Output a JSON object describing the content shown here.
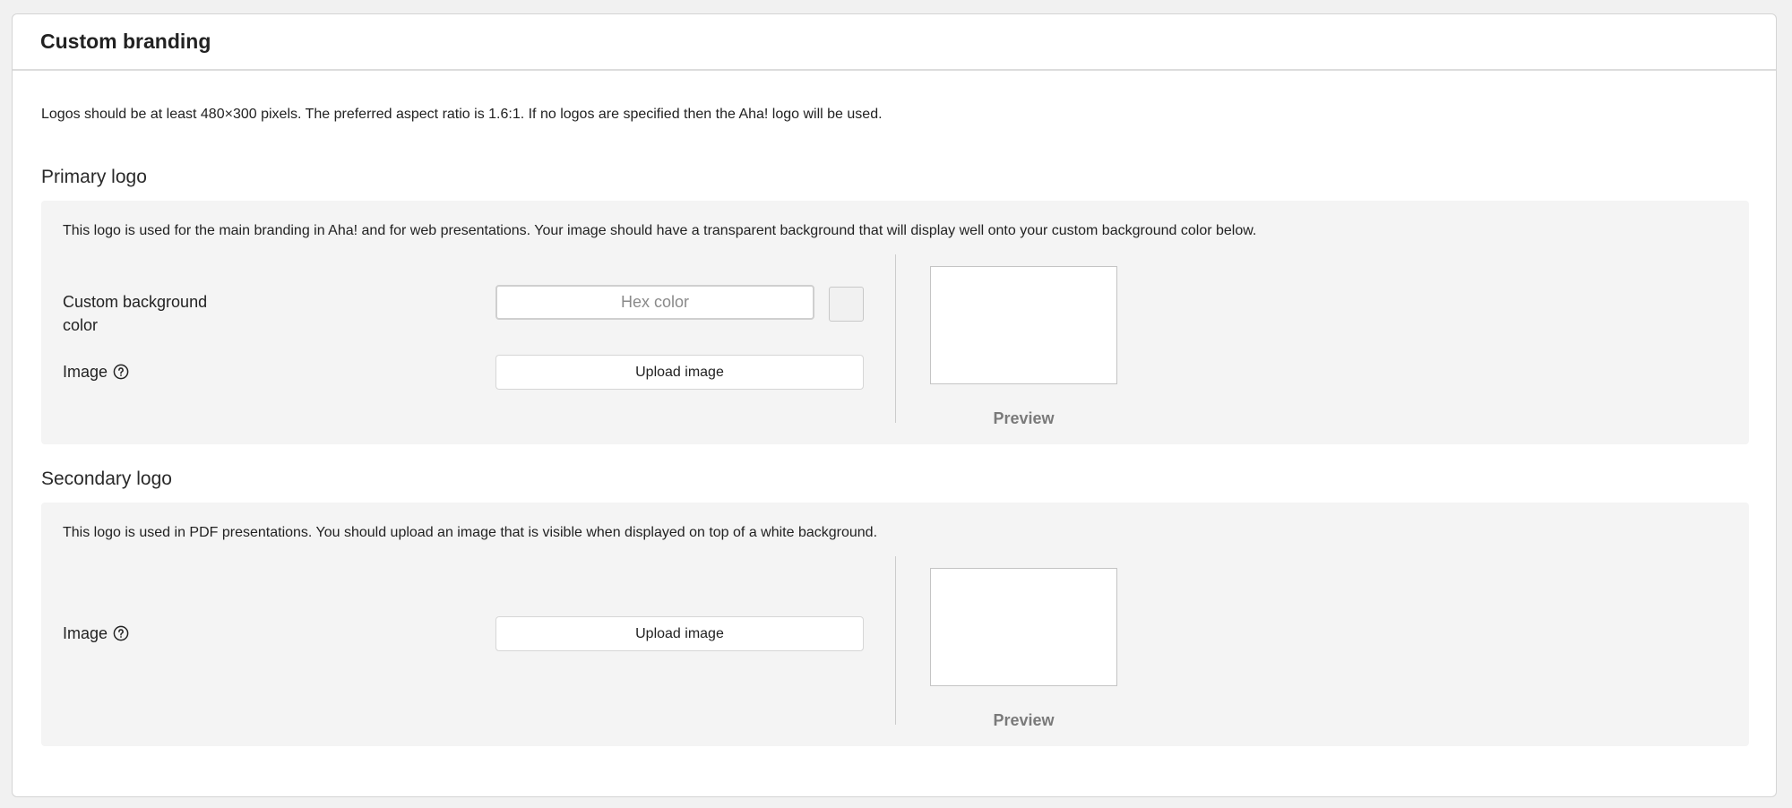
{
  "card": {
    "title": "Custom branding",
    "intro": "Logos should be at least 480×300 pixels. The preferred aspect ratio is 1.6:1. If no logos are specified then the Aha! logo will be used."
  },
  "primary": {
    "title": "Primary logo",
    "description": "This logo is used for the main branding in Aha! and for web presentations. Your image should have a transparent background that will display well onto your custom background color below.",
    "bg_label_line1": "Custom background",
    "bg_label_line2": "color",
    "hex_placeholder": "Hex color",
    "hex_value": "",
    "image_label": "Image",
    "upload_label": "Upload image",
    "preview_label": "Preview"
  },
  "secondary": {
    "title": "Secondary logo",
    "description": "This logo is used in PDF presentations. You should upload an image that is visible when displayed on top of a white background.",
    "image_label": "Image",
    "upload_label": "Upload image",
    "preview_label": "Preview"
  },
  "icons": {
    "help": "question-circle-icon"
  }
}
